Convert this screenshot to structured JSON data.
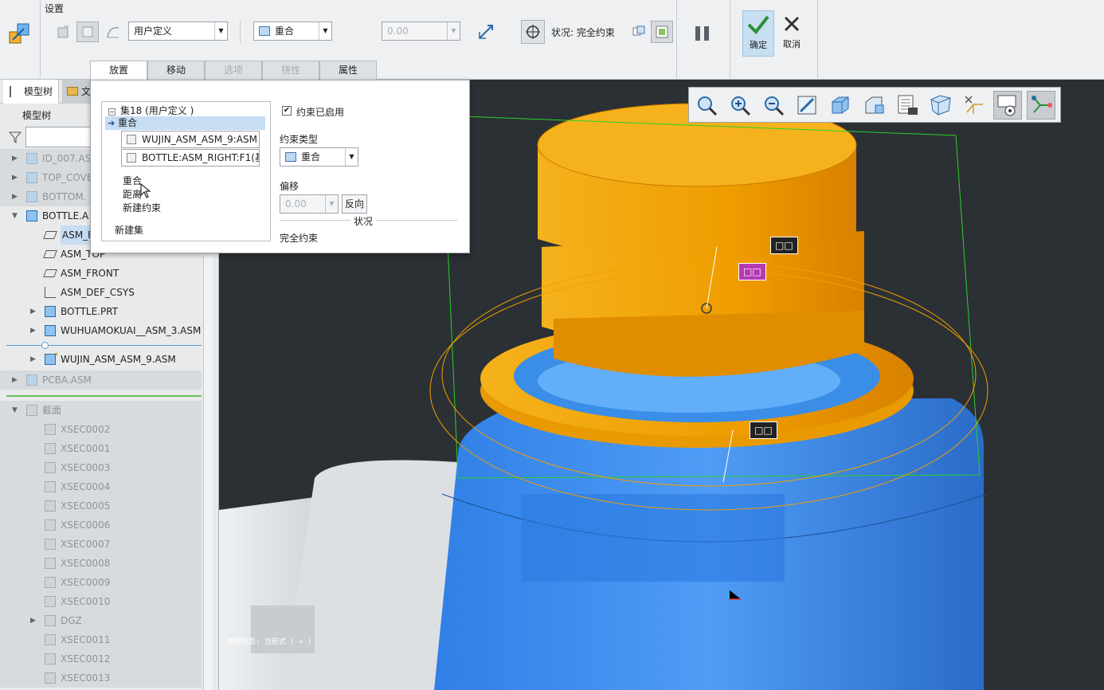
{
  "ribbon": {
    "group_title": "设置",
    "user_defined_select": "用户定义",
    "constraint_select": "重合",
    "offset_value": "0.00",
    "status": "状况: 完全约束",
    "ok_label": "确定",
    "cancel_label": "取消"
  },
  "tabs": [
    {
      "label": "放置",
      "state": "active"
    },
    {
      "label": "移动",
      "state": "normal"
    },
    {
      "label": "选项",
      "state": "disabled"
    },
    {
      "label": "挠性",
      "state": "disabled"
    },
    {
      "label": "属性",
      "state": "normal"
    }
  ],
  "placement_panel": {
    "set_header": "集18 (用户定义 )",
    "selected_constraint": "重合",
    "ref1": "WUJIN_ASM_ASM_9:ASM",
    "ref2": "BOTTLE:ASM_RIGHT:F1(基",
    "constraint_list": [
      "重合",
      "距离",
      "新建约束"
    ],
    "new_set": "新建集",
    "enabled_label": "约束已启用",
    "enabled_checked": true,
    "type_label": "约束类型",
    "type_value": "重合",
    "offset_label": "偏移",
    "offset_value": "0.00",
    "flip_button": "反向",
    "status_section": "状况",
    "status_value": "完全约束"
  },
  "left_panel": {
    "tab_model_tree": "模型树",
    "tab_second": "文",
    "header": "模型树",
    "items": [
      {
        "label": "ID_007.AS",
        "dim": true,
        "expand": "▶",
        "indent": 0,
        "icon": "part"
      },
      {
        "label": "TOP_COVE",
        "dim": true,
        "expand": "▶",
        "indent": 0,
        "icon": "part"
      },
      {
        "label": "BOTTOM.",
        "dim": true,
        "expand": "▶",
        "indent": 0,
        "icon": "part"
      },
      {
        "label": "BOTTLE.A",
        "dim": false,
        "expand": "▼",
        "indent": 0,
        "icon": "asm"
      },
      {
        "label": "ASM_R",
        "dim": false,
        "expand": "",
        "indent": 1,
        "icon": "plane",
        "highlight": true
      },
      {
        "label": "ASM_TOP",
        "dim": false,
        "expand": "",
        "indent": 1,
        "icon": "plane"
      },
      {
        "label": "ASM_FRONT",
        "dim": false,
        "expand": "",
        "indent": 1,
        "icon": "plane"
      },
      {
        "label": "ASM_DEF_CSYS",
        "dim": false,
        "expand": "",
        "indent": 1,
        "icon": "csys"
      },
      {
        "label": "BOTTLE.PRT",
        "dim": false,
        "expand": "▶",
        "indent": 1,
        "icon": "part"
      },
      {
        "label": "WUHUAMOKUAI__ASM_3.ASM",
        "dim": false,
        "expand": "▶",
        "indent": 1,
        "icon": "asm"
      },
      {
        "label": "WUJIN_ASM_ASM_9.ASM",
        "dim": false,
        "expand": "▶",
        "indent": 1,
        "icon": "asm",
        "star": true
      },
      {
        "label": "PCBA.ASM",
        "dim": true,
        "expand": "▶",
        "indent": 0,
        "icon": "part"
      },
      {
        "label": "截面",
        "dim": true,
        "expand": "▼",
        "indent": 0,
        "icon": "folder"
      },
      {
        "label": "XSEC0002",
        "dim": true,
        "expand": "",
        "indent": 1,
        "icon": "folder"
      },
      {
        "label": "XSEC0001",
        "dim": true,
        "expand": "",
        "indent": 1,
        "icon": "folder"
      },
      {
        "label": "XSEC0003",
        "dim": true,
        "expand": "",
        "indent": 1,
        "icon": "folder"
      },
      {
        "label": "XSEC0004",
        "dim": true,
        "expand": "",
        "indent": 1,
        "icon": "folder"
      },
      {
        "label": "XSEC0005",
        "dim": true,
        "expand": "",
        "indent": 1,
        "icon": "folder"
      },
      {
        "label": "XSEC0006",
        "dim": true,
        "expand": "",
        "indent": 1,
        "icon": "folder"
      },
      {
        "label": "XSEC0007",
        "dim": true,
        "expand": "",
        "indent": 1,
        "icon": "folder"
      },
      {
        "label": "XSEC0008",
        "dim": true,
        "expand": "",
        "indent": 1,
        "icon": "folder"
      },
      {
        "label": "XSEC0009",
        "dim": true,
        "expand": "",
        "indent": 1,
        "icon": "folder"
      },
      {
        "label": "XSEC0010",
        "dim": true,
        "expand": "",
        "indent": 1,
        "icon": "folder"
      },
      {
        "label": "DGZ",
        "dim": true,
        "expand": "▶",
        "indent": 1,
        "icon": "folder"
      },
      {
        "label": "XSEC0011",
        "dim": true,
        "expand": "",
        "indent": 1,
        "icon": "folder"
      },
      {
        "label": "XSEC0012",
        "dim": true,
        "expand": "",
        "indent": 1,
        "icon": "folder"
      },
      {
        "label": "XSEC0013",
        "dim": true,
        "expand": "",
        "indent": 1,
        "icon": "folder"
      }
    ]
  },
  "viewport": {
    "tags": [
      "□□",
      "□□",
      "□□"
    ],
    "status_text": "透明状态: 当前式 ( + )",
    "toolbar_icons": [
      "refit-icon",
      "zoom-in-icon",
      "zoom-out-icon",
      "repaint-icon",
      "display-style-icon",
      "saved-orientations-icon",
      "view-manager-icon",
      "perspective-icon",
      "datum-display-icon",
      "annotation-display-icon",
      "spin-center-icon"
    ]
  },
  "colors": {
    "accent": "#1d6fc0",
    "cap": "#f0a000",
    "bottle": "#3d8ff0"
  }
}
